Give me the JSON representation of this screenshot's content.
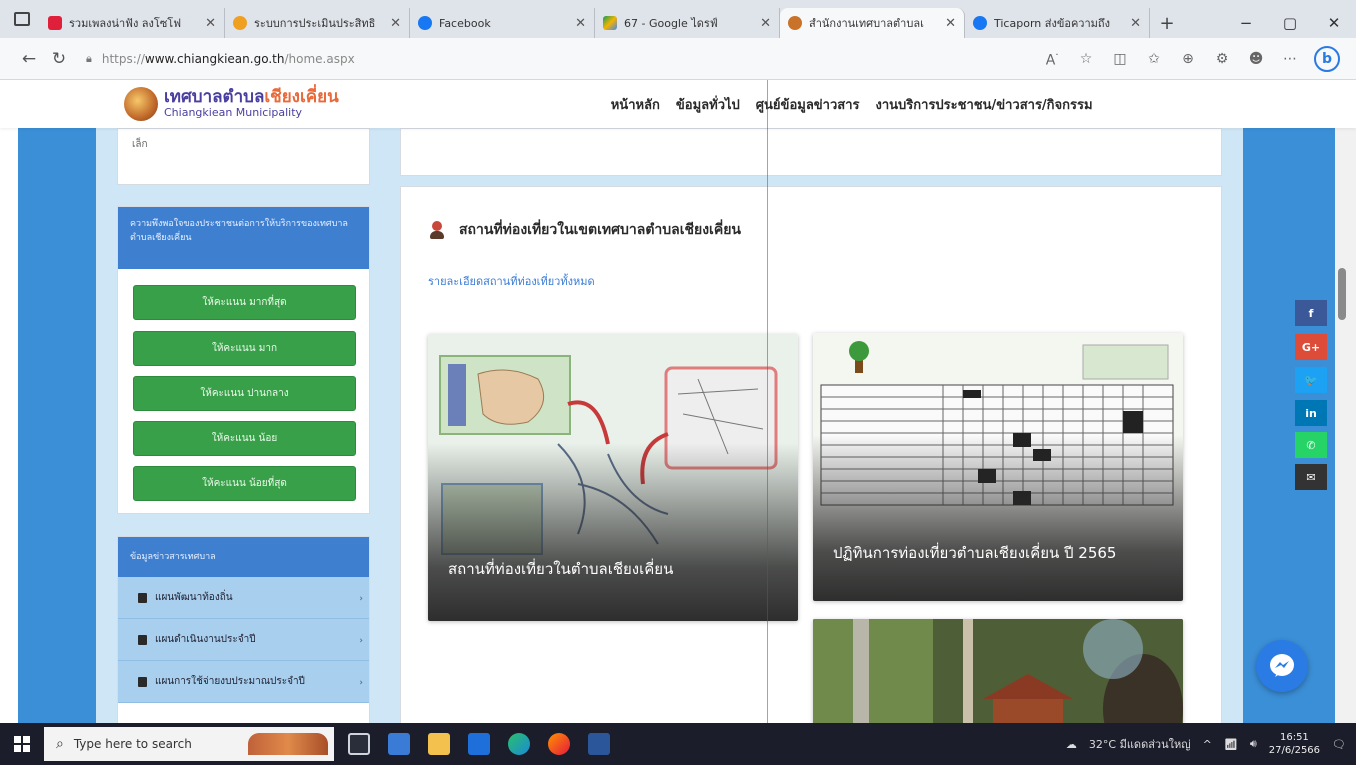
{
  "browser": {
    "tabs": [
      {
        "label": "รวมเพลงน่าฟัง ลงโซโฟ",
        "favicon_color": "#e0203a"
      },
      {
        "label": "ระบบการประเมินประสิทธิ",
        "favicon_color": "#f0a020"
      },
      {
        "label": "Facebook",
        "favicon_color": "#1877f2"
      },
      {
        "label": "67 - Google ไดรฟ์",
        "favicon_color": "#f4b400"
      },
      {
        "label": "สำนักงานเทศบาลตำบลเ",
        "favicon_color": "#c8722a",
        "active": true
      },
      {
        "label": "Ticaporn ส่งข้อความถึง",
        "favicon_color": "#1877f2"
      }
    ],
    "new_tab_symbol": "+",
    "window_controls": [
      "−",
      "▢",
      "✕"
    ],
    "url_prefix": "https://",
    "url_domain": "www.chiangkiean.go.th",
    "url_path": "/home.aspx"
  },
  "site": {
    "logo_th_main": "เทศบาลตำบล",
    "logo_th_highlight": "เชียงเคี่ยน",
    "logo_en": "Chiangkiean Municipality",
    "nav": [
      "หน้าหลัก",
      "ข้อมูลทั่วไป",
      "ศูนย์ข้อมูลข่าวสาร",
      "งานบริการประชาชน/ข่าวสาร/กิจกรรม"
    ]
  },
  "sidebar": {
    "top_fragment": "เล็ก",
    "survey_title": "ความพึงพอใจของประชาชนต่อการให้บริการของเทศบาลตำบลเชียงเคี่ยน",
    "vote_buttons": [
      "ให้คะแนน มากที่สุด",
      "ให้คะแนน มาก",
      "ให้คะแนน ปานกลาง",
      "ให้คะแนน น้อย",
      "ให้คะแนน น้อยที่สุด"
    ],
    "info_title": "ข้อมูลข่าวสารเทศบาล",
    "info_items": [
      "แผนพัฒนาท้องถิ่น",
      "แผนดำเนินงานประจำปี",
      "แผนการใช้จ่ายงบประมาณประจำปี"
    ]
  },
  "main": {
    "section_title": "สถานที่ท่องเที่ยวในเขตเทศบาลตำบลเชียงเคี่ยน",
    "all_link": "รายละเอียดสถานที่ท่องเที่ยวทั้งหมด",
    "cards": [
      {
        "caption": "สถานที่ท่องเที่ยวในตำบลเชียงเคี่ยน"
      },
      {
        "caption": "ปฏิทินการท่องเที่ยวตำบลเชียงเคี่ยน ปี 2565"
      },
      {
        "caption": ""
      }
    ]
  },
  "social": [
    {
      "icon": "facebook-icon",
      "glyph": "f",
      "color": "#3b5998"
    },
    {
      "icon": "google-plus-icon",
      "glyph": "G+",
      "color": "#dd4b39"
    },
    {
      "icon": "twitter-icon",
      "glyph": "🐦",
      "color": "#1da1f2"
    },
    {
      "icon": "linkedin-icon",
      "glyph": "in",
      "color": "#0077b5"
    },
    {
      "icon": "whatsapp-icon",
      "glyph": "✆",
      "color": "#25d366"
    },
    {
      "icon": "email-icon",
      "glyph": "✉",
      "color": "#333333"
    }
  ],
  "taskbar": {
    "search_placeholder": "Type here to search",
    "weather": "32°C มีแดดส่วนใหญ่",
    "time": "16:51",
    "date": "27/6/2566"
  }
}
